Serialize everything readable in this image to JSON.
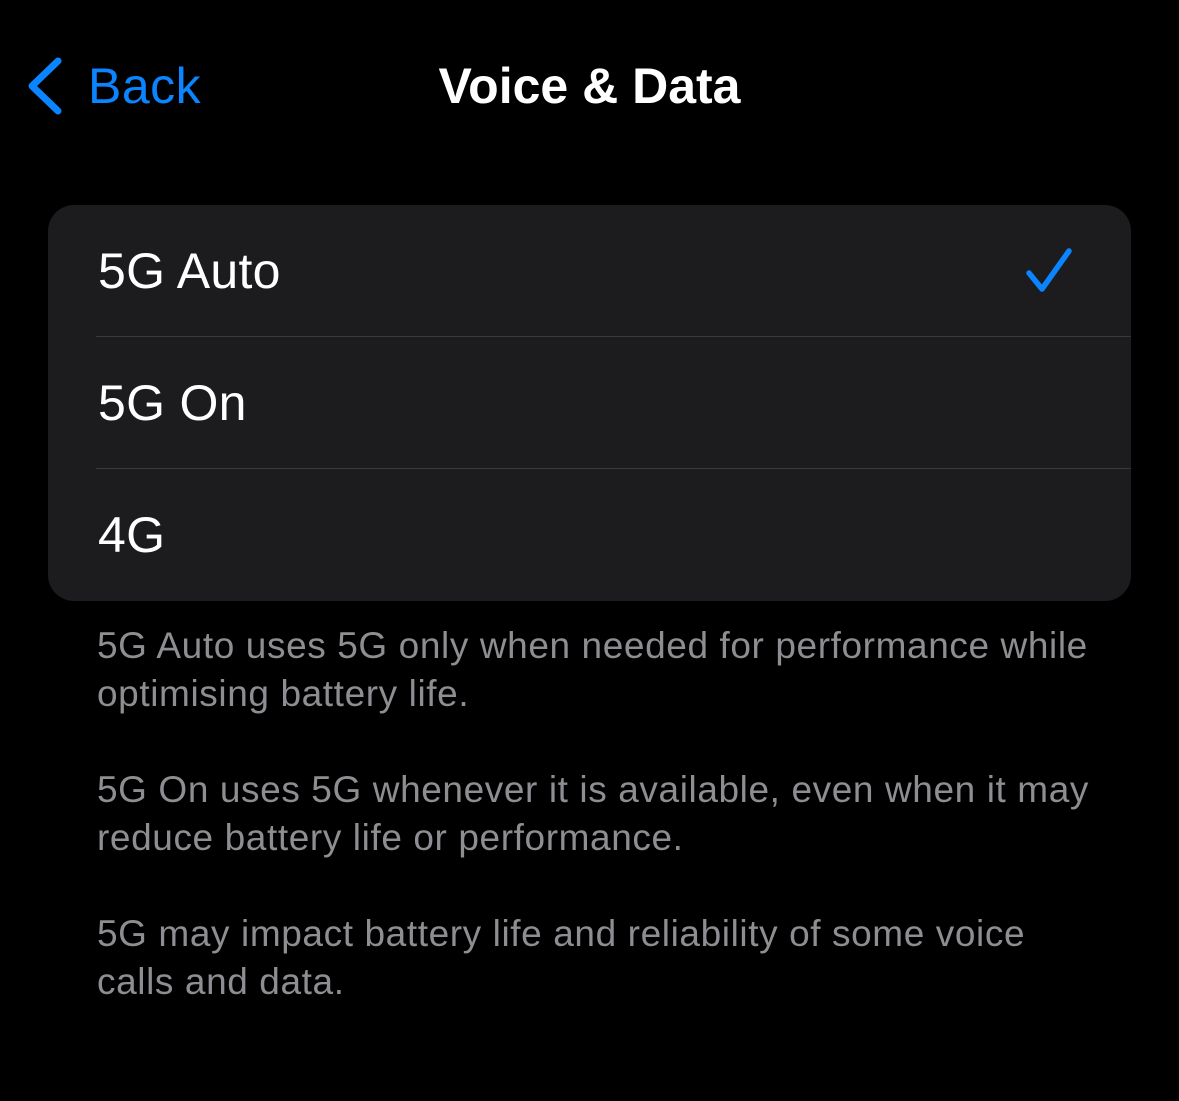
{
  "nav": {
    "back_label": "Back",
    "title": "Voice & Data"
  },
  "options": [
    {
      "label": "5G Auto",
      "selected": true
    },
    {
      "label": "5G On",
      "selected": false
    },
    {
      "label": "4G",
      "selected": false
    }
  ],
  "footnotes": [
    "5G Auto uses 5G only when needed for performance while optimising battery life.",
    "5G On uses 5G whenever it is available, even when it may reduce battery life or performance.",
    "5G may impact battery life and reliability of some voice calls and data."
  ],
  "colors": {
    "accent": "#0a84ff",
    "background": "#000000",
    "card": "#1c1c1e",
    "secondary_text": "#8d8d92"
  },
  "icons": {
    "back": "chevron-left-icon",
    "selected": "checkmark-icon"
  }
}
